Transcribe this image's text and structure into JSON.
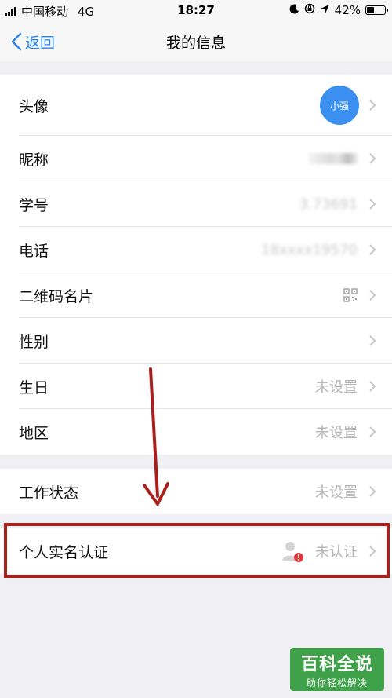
{
  "status_bar": {
    "carrier": "中国移动",
    "network": "4G",
    "time": "18:27",
    "battery": "42%",
    "battery_level": 0.42
  },
  "nav": {
    "back_label": "返回",
    "title": "我的信息"
  },
  "profile": {
    "avatar_label": "头像",
    "avatar_text": "小强",
    "nickname_label": "昵称",
    "student_id_label": "学号",
    "student_id_value": "3.73691",
    "phone_label": "电话",
    "phone_value": "18xxxx19570",
    "qrcode_label": "二维码名片",
    "gender_label": "性别",
    "birthday_label": "生日",
    "birthday_value": "未设置",
    "region_label": "地区",
    "region_value": "未设置"
  },
  "work": {
    "status_label": "工作状态",
    "status_value": "未设置"
  },
  "verification": {
    "label": "个人实名认证",
    "value": "未认证"
  },
  "watermark": {
    "title": "百科全说",
    "subtitle": "助你轻松解决"
  },
  "colors": {
    "accent": "#2b84ea",
    "annotation": "#a8201c",
    "watermark": "#3fa24a"
  }
}
